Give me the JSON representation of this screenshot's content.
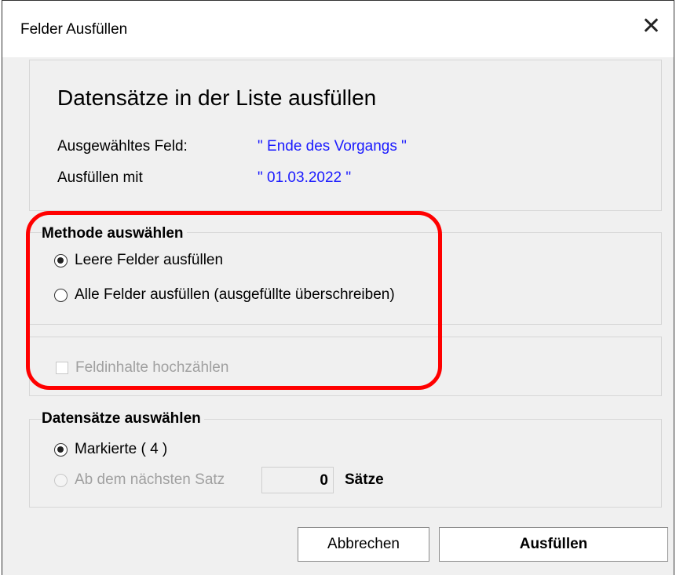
{
  "window": {
    "title": "Felder Ausfüllen",
    "close_glyph": "✕"
  },
  "info": {
    "heading": "Datensätze in der Liste ausfüllen",
    "field_label": "Ausgewähltes Feld:",
    "field_value": "\" Ende des Vorgangs \"",
    "fill_label": "Ausfüllen mit",
    "fill_value": "\" 01.03.2022 \""
  },
  "method": {
    "label": "Methode auswählen",
    "options": [
      {
        "label": "Leere Felder ausfüllen",
        "checked": true
      },
      {
        "label": "Alle Felder ausfüllen (ausgefüllte überschreiben)",
        "checked": false
      }
    ],
    "increment_label": "Feldinhalte hochzählen",
    "increment_checked": false
  },
  "records": {
    "label": "Datensätze auswählen",
    "options": [
      {
        "label": "Markierte ( 4 )",
        "checked": true
      },
      {
        "label": "Ab dem nächsten Satz",
        "checked": false,
        "disabled": true
      }
    ],
    "count_value": "0",
    "count_unit": "Sätze"
  },
  "buttons": {
    "cancel": "Abbrechen",
    "fill": "Ausfüllen"
  },
  "colors": {
    "value_text": "#1a1aff",
    "highlight": "#ff0000"
  }
}
